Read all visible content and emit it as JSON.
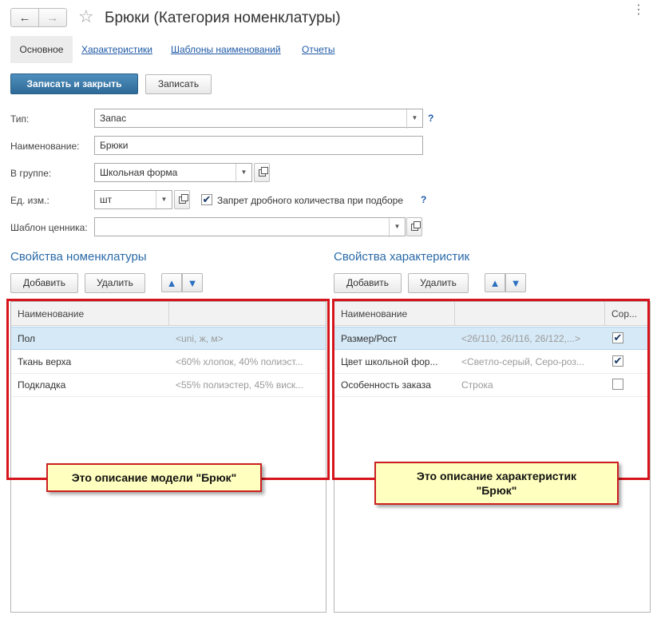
{
  "window": {
    "title": "Брюки (Категория номенклатуры)",
    "back_icon": "arrow-left-icon",
    "forward_icon": "arrow-right-icon",
    "favorite_icon": "star-icon",
    "more_label": "⋮"
  },
  "tabs": [
    {
      "label": "Основное",
      "active": true
    },
    {
      "label": "Характеристики",
      "active": false
    },
    {
      "label": "Шаблоны наименований",
      "active": false
    },
    {
      "label": "Отчеты",
      "active": false
    }
  ],
  "toolbar": {
    "save_close_label": "Записать и закрыть",
    "save_label": "Записать"
  },
  "form": {
    "type_label": "Тип:",
    "type_value": "Запас",
    "help_label": "?",
    "name_label": "Наименование:",
    "name_value": "Брюки",
    "group_label": "В группе:",
    "group_value": "Школьная форма",
    "unit_label": "Ед. изм.:",
    "unit_value": "шт",
    "fraction_ban_label": "Запрет дробного количества при подборе",
    "fraction_ban_checked": true,
    "price_template_label": "Шаблон ценника:",
    "price_template_value": ""
  },
  "left_section": {
    "title": "Свойства номенклатуры",
    "add_label": "Добавить",
    "delete_label": "Удалить",
    "columns": [
      "Наименование",
      ""
    ],
    "rows": [
      {
        "name": "Пол",
        "value": "<uni, ж, м>",
        "selected": true
      },
      {
        "name": "Ткань верха",
        "value": "<60% хлопок, 40% полиэст...",
        "selected": false
      },
      {
        "name": "Подкладка",
        "value": "<55% полиэстер, 45% виск...",
        "selected": false
      }
    ],
    "note": "Это описание модели \"Брюк\""
  },
  "right_section": {
    "title": "Свойства характеристик",
    "add_label": "Добавить",
    "delete_label": "Удалить",
    "columns": [
      "Наименование",
      "",
      "Сор..."
    ],
    "rows": [
      {
        "name": "Размер/Рост",
        "value": "<26/110, 26/116, 26/122,...>",
        "checked": true,
        "selected": true
      },
      {
        "name": "Цвет школьной фор...",
        "value": "<Светло-серый, Серо-роз...",
        "checked": true,
        "selected": false
      },
      {
        "name": "Особенность заказа",
        "value": "Строка",
        "checked": false,
        "selected": false
      }
    ],
    "note_line1": "Это описание характеристик",
    "note_line2": "\"Брюк\""
  },
  "colors": {
    "primary_button": "#2f6a98",
    "link": "#1f5aa6",
    "section_title": "#2a6aa8",
    "highlight_frame": "#d6141b",
    "note_bg": "#ffffbf",
    "selected_row": "#d6e9f6"
  }
}
